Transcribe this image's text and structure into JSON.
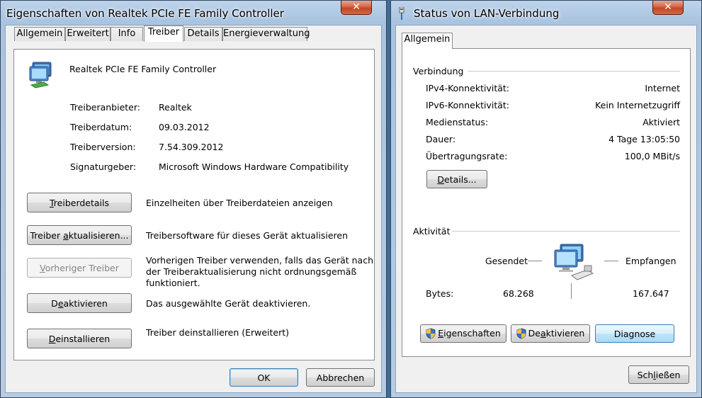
{
  "left_window": {
    "title": "Eigenschaften von Realtek PCIe FE Family Controller",
    "close_symbol": "✕",
    "tabs": [
      "Allgemein",
      "Erweitert",
      "Info",
      "Treiber",
      "Details",
      "Energieverwaltung"
    ],
    "active_tab": "Treiber",
    "device_icon": "network-adapter-icon",
    "device_name": "Realtek PCIe FE Family Controller",
    "properties": [
      {
        "label": "Treiberanbieter:",
        "value": "Realtek"
      },
      {
        "label": "Treiberdatum:",
        "value": "09.03.2012"
      },
      {
        "label": "Treiberversion:",
        "value": "7.54.309.2012"
      },
      {
        "label": "Signaturgeber:",
        "value": "Microsoft Windows Hardware Compatibility"
      }
    ],
    "actions": [
      {
        "button": "Treiberdetails",
        "accel": "T",
        "rest": "reiberdetails",
        "description": "Einzelheiten über Treiberdateien anzeigen"
      },
      {
        "button": "Treiber aktualisieren...",
        "pre": "Treiber ",
        "accel": "a",
        "rest": "ktualisieren...",
        "description": "Treibersoftware für dieses Gerät aktualisieren"
      },
      {
        "button": "Vorheriger Treiber",
        "accel": "V",
        "rest": "orheriger Treiber",
        "description_lines": [
          "Vorherigen Treiber verwenden, falls das Gerät nach",
          "der Treiberaktualisierung nicht ordnungsgemäß",
          "funktioniert."
        ]
      },
      {
        "button": "Deaktivieren",
        "pre": "D",
        "accel": "e",
        "rest": "aktivieren",
        "description": "Das ausgewählte Gerät deaktivieren."
      },
      {
        "button": "Deinstallieren",
        "accel": "D",
        "rest": "einstallieren",
        "description": "Treiber deinstallieren (Erweitert)"
      }
    ],
    "ok_label": "OK",
    "cancel_label": "Abbrechen"
  },
  "right_window": {
    "title": "Status von LAN-Verbindung",
    "close_symbol": "✕",
    "tab": "Allgemein",
    "connection_header": "Verbindung",
    "connection_rows": [
      {
        "label": "IPv4-Konnektivität:",
        "value": "Internet"
      },
      {
        "label": "IPv6-Konnektivität:",
        "value": "Kein Internetzugriff"
      },
      {
        "label": "Medienstatus:",
        "value": "Aktiviert"
      },
      {
        "label": "Dauer:",
        "value": "4 Tage 13:05:50"
      },
      {
        "label": "Übertragungsrate:",
        "value": "100,0 MBit/s"
      }
    ],
    "details_button": {
      "accel": "D",
      "rest": "etails..."
    },
    "activity_header": "Aktivität",
    "sent_label": "Gesendet",
    "received_label": "Empfangen",
    "bytes_label": "Bytes:",
    "bytes_sent": "68.268",
    "bytes_received": "167.647",
    "properties_button": {
      "accel": "E",
      "rest": "igenschaften"
    },
    "deactivate_button": {
      "pre": "De",
      "accel": "a",
      "rest": "ktivieren"
    },
    "diagnose_label": "Diagnose",
    "close_button": {
      "pre": "Sch",
      "accel": "l",
      "rest": "ießen"
    }
  }
}
